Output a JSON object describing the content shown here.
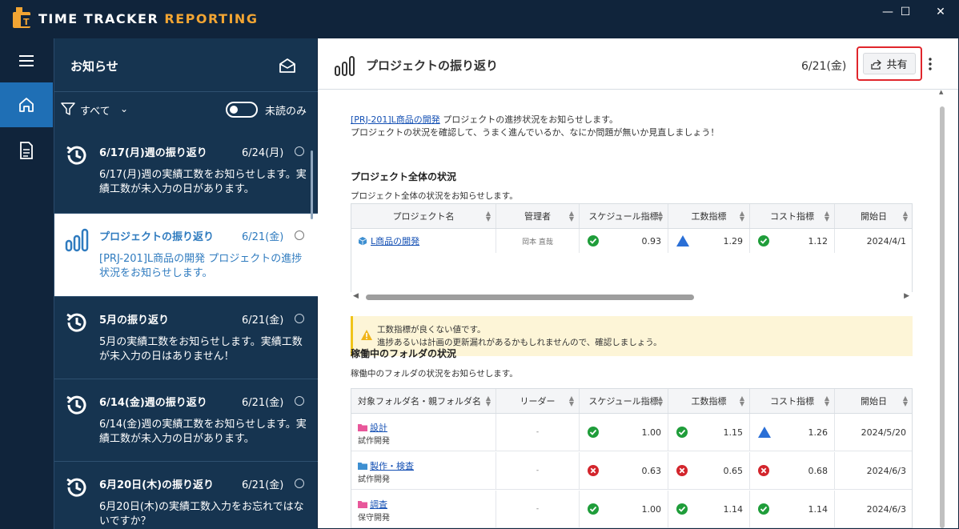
{
  "app": {
    "title_main": "TIME TRACKER ",
    "title_accent": "REPORTING"
  },
  "window": {
    "minimize": "—",
    "maximize": "☐",
    "close": "✕"
  },
  "notifications": {
    "title": "お知らせ",
    "filter_label": "すべて",
    "unread_only_label": "未読のみ",
    "items": [
      {
        "title": "6/17(月)週の振り返り",
        "date": "6/24(月)",
        "body": "6/17(月)週の実績工数をお知らせします。実績工数が未入力の日があります。",
        "icon": "history-icon"
      },
      {
        "title": "プロジェクトの振り返り",
        "date": "6/21(金)",
        "body": "[PRJ-201]L商品の開発 プロジェクトの進捗状況をお知らせします。",
        "icon": "chart-bars-icon"
      },
      {
        "title": "5月の振り返り",
        "date": "6/21(金)",
        "body": "5月の実績工数をお知らせします。実績工数が未入力の日はありません！",
        "icon": "history-icon"
      },
      {
        "title": "6/14(金)週の振り返り",
        "date": "6/21(金)",
        "body": "6/14(金)週の実績工数をお知らせします。実績工数が未入力の日があります。",
        "icon": "history-icon"
      },
      {
        "title": "6月20日(木)の振り返り",
        "date": "6/21(金)",
        "body": "6月20日(木)の実績工数入力をお忘れではないですか？",
        "icon": "history-icon"
      }
    ]
  },
  "main": {
    "title": "プロジェクトの振り返り",
    "date": "6/21(金)",
    "share_label": "共有",
    "intro_link": "[PRJ-201]L商品の開発",
    "intro_line1_rest": " プロジェクトの進捗状況をお知らせします。",
    "intro_line2": "プロジェクトの状況を確認して、うまく進んでいるか、なにか問題が無いか見直しましょう！",
    "section1": {
      "title": "プロジェクト全体の状況",
      "subtitle": "プロジェクト全体の状況をお知らせします。",
      "headers": [
        "プロジェクト名",
        "管理者",
        "スケジュール指標",
        "工数指標",
        "コスト指標",
        "開始日"
      ],
      "rows": [
        {
          "name": "L商品の開発",
          "manager": "岡本 直哉",
          "schedule": "0.93",
          "schedule_status": "good",
          "effort": "1.29",
          "effort_status": "warn",
          "cost": "1.12",
          "cost_status": "good",
          "start": "2024/4/1"
        }
      ]
    },
    "warning": {
      "line1": "工数指標が良くない値です。",
      "line2": "進捗あるいは計画の更新漏れがあるかもしれませんので、確認しましょう。"
    },
    "section2": {
      "title": "稼働中のフォルダの状況",
      "subtitle": "稼働中のフォルダの状況をお知らせします。",
      "headers": [
        "対象フォルダ名・親フォルダ名",
        "リーダー",
        "スケジュール指標",
        "工数指標",
        "コスト指標",
        "開始日"
      ],
      "rows": [
        {
          "name": "設計",
          "parent": "試作開発",
          "folder_color": "#e8579a",
          "leader": "-",
          "schedule": "1.00",
          "schedule_status": "good",
          "effort": "1.15",
          "effort_status": "good",
          "cost": "1.26",
          "cost_status": "warn",
          "start": "2024/5/20"
        },
        {
          "name": "製作・検査",
          "parent": "試作開発",
          "folder_color": "#3d8fd1",
          "leader": "-",
          "schedule": "0.63",
          "schedule_status": "bad",
          "effort": "0.65",
          "effort_status": "bad",
          "cost": "0.68",
          "cost_status": "bad",
          "start": "2024/6/3"
        },
        {
          "name": "調査",
          "parent": "保守開発",
          "folder_color": "#e8579a",
          "leader": "-",
          "schedule": "1.00",
          "schedule_status": "good",
          "effort": "1.14",
          "effort_status": "good",
          "cost": "1.14",
          "cost_status": "good",
          "start": "2024/6/3"
        }
      ]
    }
  },
  "colors": {
    "good": "#1f9d3a",
    "bad": "#d3252c",
    "warn": "#2a6fd6",
    "accent": "#f2a533",
    "rail_active": "#1f6fb5",
    "highlight": "#e0262c"
  }
}
